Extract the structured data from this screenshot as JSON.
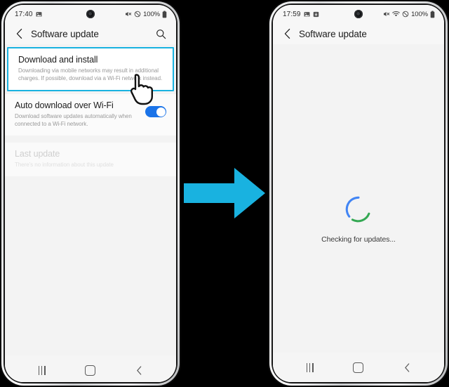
{
  "meta": {
    "accent_cyan": "#19b2e0",
    "toggle_blue": "#1a73e8",
    "spinner_blue": "#4285f4",
    "spinner_green": "#34a853",
    "page_background": "#000000",
    "screen_background": "#f3f3f3"
  },
  "arrow": {
    "name": "flow-arrow",
    "color": "#19b2e0",
    "direction": "right"
  },
  "phones": [
    {
      "id": "left",
      "status_bar": {
        "time": "17:40",
        "left_icons": [
          "image-icon"
        ],
        "right_icons": [
          "mute-icon",
          "do-not-disturb-icon"
        ],
        "battery_percent": "100%",
        "battery_icon": "battery-full-icon"
      },
      "header": {
        "back_icon": "chevron-left-icon",
        "title": "Software update",
        "search_icon": "search-icon",
        "has_search": true
      },
      "items": [
        {
          "name": "download-and-install",
          "title": "Download and install",
          "subtitle": "Downloading via mobile networks may result in additional charges. If possible, download via a Wi-Fi network instead.",
          "highlighted": true,
          "faded": false,
          "toggle": null
        },
        {
          "name": "auto-download-over-wifi",
          "title": "Auto download over Wi-Fi",
          "subtitle": "Download software updates automatically when connected to a Wi-Fi network.",
          "highlighted": false,
          "faded": false,
          "toggle": "on"
        },
        {
          "name": "last-update",
          "title": "Last update",
          "subtitle": "There's no information about this update",
          "highlighted": false,
          "faded": true,
          "toggle": null
        }
      ],
      "cursor": {
        "name": "tap-hand-cursor",
        "visible": true
      },
      "checking": null,
      "nav_bar": {
        "recents_label": "recent-apps-icon",
        "home_label": "home-icon",
        "back_label": "back-icon"
      }
    },
    {
      "id": "right",
      "status_bar": {
        "time": "17:59",
        "left_icons": [
          "image-icon",
          "screenshot-icon"
        ],
        "right_icons": [
          "mute-icon",
          "wifi-icon",
          "do-not-disturb-icon"
        ],
        "battery_percent": "100%",
        "battery_icon": "battery-full-icon"
      },
      "header": {
        "back_icon": "chevron-left-icon",
        "title": "Software update",
        "search_icon": "search-icon",
        "has_search": false
      },
      "items": [],
      "cursor": {
        "name": "tap-hand-cursor",
        "visible": false
      },
      "checking": {
        "label": "Checking for updates...",
        "spinner_name": "loading-spinner"
      },
      "nav_bar": {
        "recents_label": "recent-apps-icon",
        "home_label": "home-icon",
        "back_label": "back-icon"
      }
    }
  ]
}
